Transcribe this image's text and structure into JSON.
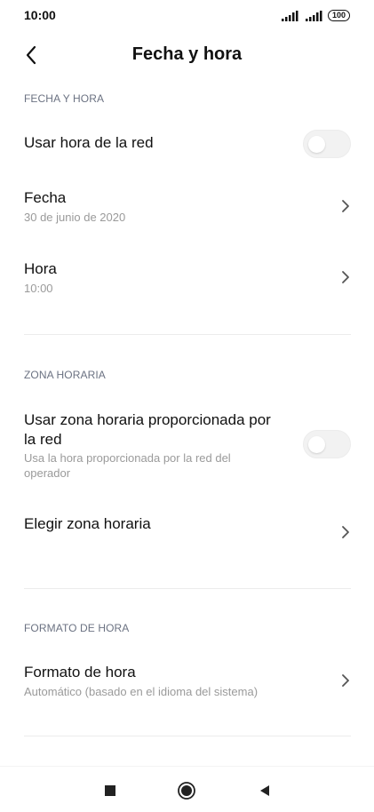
{
  "status_bar": {
    "time": "10:00",
    "battery": "100"
  },
  "header": {
    "title": "Fecha y hora",
    "back_icon": "chevron-left-icon"
  },
  "sections": {
    "date_time": {
      "header": "FECHA Y HORA",
      "network_time": {
        "label": "Usar hora de la red",
        "enabled": false
      },
      "date": {
        "label": "Fecha",
        "value": "30 de junio de 2020"
      },
      "time": {
        "label": "Hora",
        "value": "10:00"
      }
    },
    "time_zone": {
      "header": "ZONA HORARIA",
      "network_zone": {
        "label_line1": "Usar zona horaria proporcionada por",
        "label_line2": "la red",
        "desc_line1": "Usa la hora proporcionada por la red del",
        "desc_line2": "operador",
        "enabled": false
      },
      "choose_zone": {
        "label": "Elegir zona horaria"
      }
    },
    "time_format": {
      "header": "FORMATO DE HORA",
      "format": {
        "label": "Formato de hora",
        "value": "Automático (basado en el idioma del sistema)"
      }
    }
  },
  "nav_bar": {
    "recents_icon": "square-icon",
    "home_icon": "circle-icon",
    "back_icon": "triangle-left-icon"
  },
  "colors": {
    "section_header": "#6b7282",
    "subtitle": "#9a9a9a",
    "toggle_track": "#f2f2f2",
    "divider": "#ececec"
  }
}
